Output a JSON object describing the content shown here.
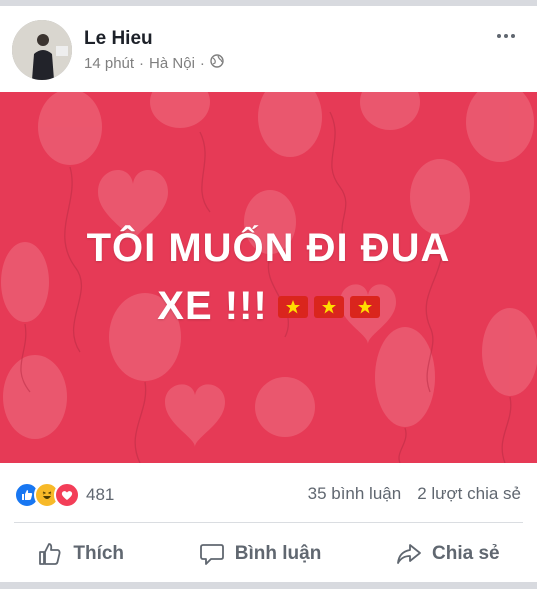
{
  "post": {
    "author": "Le Hieu",
    "time": "14 phút",
    "location": "Hà Nội",
    "separator": "·",
    "banner_line1": "TÔI MUỐN ĐI ĐUA",
    "banner_line2": "XE !!!",
    "banner_color": "#e63a56"
  },
  "stats": {
    "reaction_count": "481",
    "comments": "35 bình luận",
    "shares": "2 lượt chia sẻ",
    "reaction_icons": [
      "like-icon",
      "haha-icon",
      "love-icon"
    ]
  },
  "actions": {
    "like": "Thích",
    "comment": "Bình luận",
    "share": "Chia sẻ"
  }
}
